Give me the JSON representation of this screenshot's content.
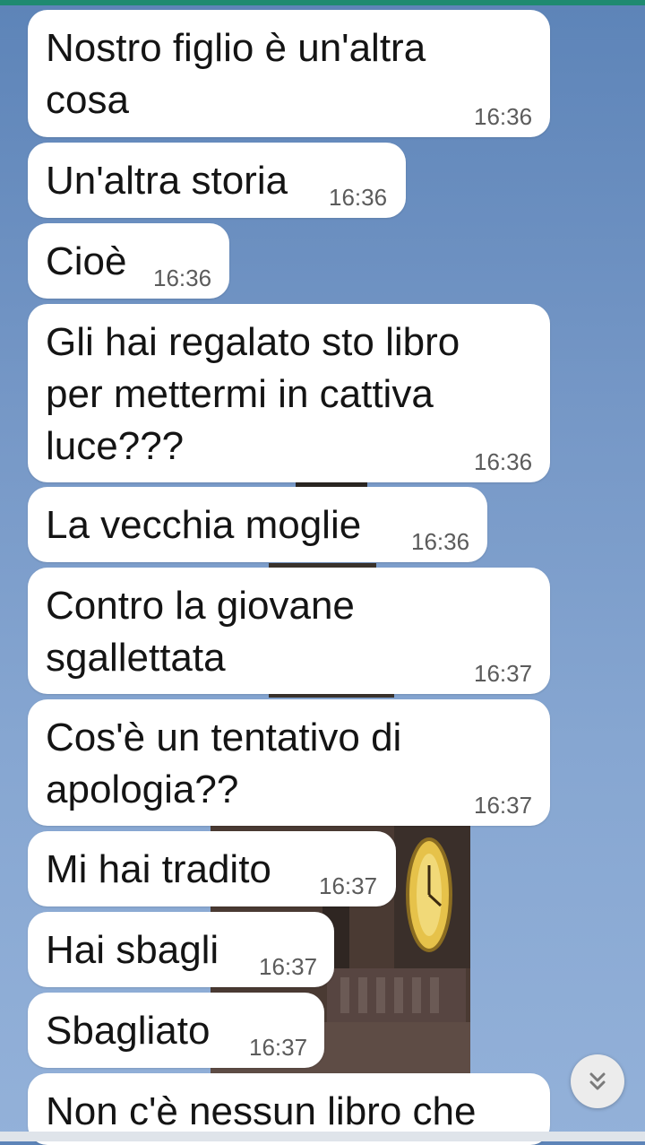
{
  "messages": [
    {
      "text": "Nostro figlio è un'altra\ncosa",
      "time": "16:36"
    },
    {
      "text": "Un'altra storia",
      "time": "16:36"
    },
    {
      "text": "Cioè",
      "time": "16:36"
    },
    {
      "text": "Gli hai regalato sto libro\nper mettermi in cattiva\nluce???",
      "time": "16:36"
    },
    {
      "text": "La vecchia moglie",
      "time": "16:36"
    },
    {
      "text": "Contro la giovane\nsgallettata",
      "time": "16:37"
    },
    {
      "text": "Cos'è un tentativo di\napologia??",
      "time": "16:37"
    },
    {
      "text": "Mi hai tradito",
      "time": "16:37"
    },
    {
      "text": "Hai sbagli",
      "time": "16:37"
    },
    {
      "text": "Sbagliato",
      "time": "16:37"
    },
    {
      "text": "Non c'è nessun libro che",
      "time": ""
    }
  ],
  "scroll_button": {
    "icon": "double-chevron-down-icon"
  },
  "colors": {
    "top_bar": "#1f8a70",
    "bubble": "#ffffff",
    "wallpaper_sky": "#7597c6"
  }
}
